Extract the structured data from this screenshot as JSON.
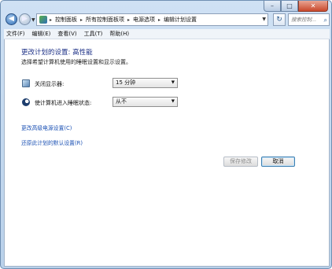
{
  "nav": {
    "breadcrumbs": [
      "控制面板",
      "所有控制面板项",
      "电源选项",
      "编辑计划设置"
    ],
    "search_placeholder": "搜索控制..."
  },
  "menu": [
    "文件(F)",
    "编辑(E)",
    "查看(V)",
    "工具(T)",
    "帮助(H)"
  ],
  "main": {
    "title": "更改计划的设置: 高性能",
    "subtitle": "选择希望计算机使用的睡眠设置和显示设置。",
    "settings": [
      {
        "label": "关闭显示器:",
        "value": "15 分钟",
        "icon": "monitor-icon"
      },
      {
        "label": "使计算机进入睡眠状态:",
        "value": "从不",
        "icon": "sleep-moon-icon"
      }
    ],
    "links": {
      "advanced": "更改高级电源设置(C)",
      "restore": "还原此计划的默认设置(R)"
    },
    "buttons": {
      "save": "保存修改",
      "cancel": "取消"
    }
  }
}
